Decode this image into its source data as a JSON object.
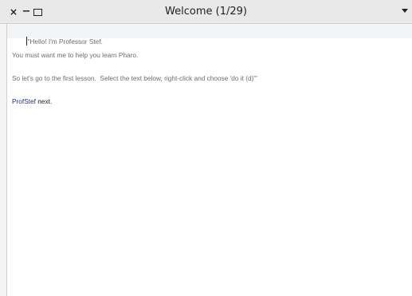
{
  "window": {
    "title": "Welcome (1/29)",
    "close_glyph": "×",
    "minimize_glyph": "−",
    "menu_icon": "chevron-down-icon"
  },
  "editor": {
    "lines": [
      "\"Hello! I'm Professor Stef.",
      "You must want me to help you learn Pharo.",
      "So let's go to the first lesson.  Select the text below, right-click and choose 'do it (d)'\""
    ],
    "code_object": "ProfStef",
    "code_message": " next."
  }
}
